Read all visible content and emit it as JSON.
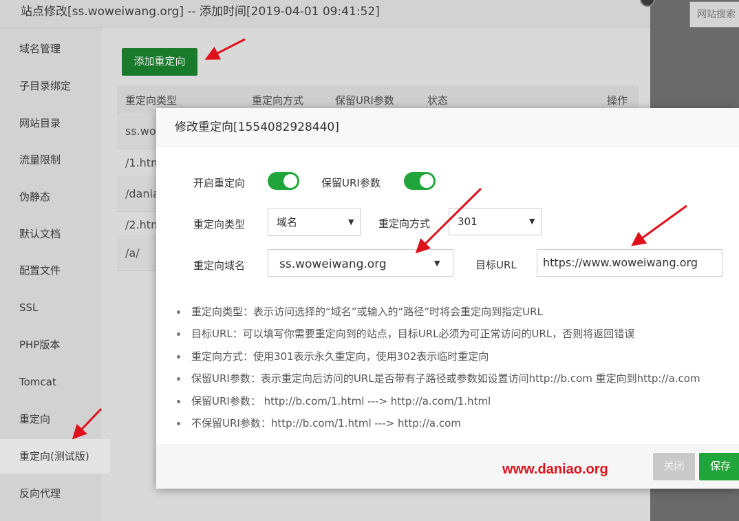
{
  "background": {
    "search_text": "网站搜索"
  },
  "outer_modal": {
    "title": "站点修改[ss.woweiwang.org] -- 添加时间[2019-04-01 09:41:52]",
    "sidebar": {
      "items": [
        {
          "label": "域名管理"
        },
        {
          "label": "子目录绑定"
        },
        {
          "label": "网站目录"
        },
        {
          "label": "流量限制"
        },
        {
          "label": "伪静态"
        },
        {
          "label": "默认文档"
        },
        {
          "label": "配置文件"
        },
        {
          "label": "SSL"
        },
        {
          "label": "PHP版本"
        },
        {
          "label": "Tomcat"
        },
        {
          "label": "重定向"
        },
        {
          "label": "重定向(测试版)"
        },
        {
          "label": "反向代理"
        }
      ],
      "active": "重定向(测试版)"
    },
    "add_button": "添加重定向",
    "table": {
      "headers": [
        "重定向类型",
        "重定向方式",
        "保留URI参数",
        "状态",
        "操作"
      ],
      "rows": [
        {
          "first_cell": "ss.wow"
        },
        {
          "first_cell": "/1.htm"
        },
        {
          "first_cell": "/dania"
        },
        {
          "first_cell": "/2.htm"
        },
        {
          "first_cell": "/a/"
        }
      ]
    }
  },
  "modal": {
    "title": "修改重定向[1554082928440]",
    "enable_label": "开启重定向",
    "enable_on": true,
    "keep_uri_label": "保留URI参数",
    "keep_uri_on": true,
    "type_label": "重定向类型",
    "type_value": "域名",
    "method_label": "重定向方式",
    "method_value": "301",
    "domain_label": "重定向域名",
    "domain_value": "ss.woweiwang.org",
    "target_label": "目标URL",
    "target_value": "https://www.woweiwang.org",
    "tips": [
      "重定向类型：表示访问选择的“域名”或输入的“路径”时将会重定向到指定URL",
      "目标URL：可以填写你需要重定向到的站点，目标URL必须为可正常访问的URL，否则将返回错误",
      "重定向方式：使用301表示永久重定向，使用302表示临时重定向",
      "保留URI参数：表示重定向后访问的URL是否带有子路径或参数如设置访问http://b.com 重定向到http://a.com",
      "保留URI参数：  http://b.com/1.html ---> http://a.com/1.html",
      "不保留URI参数：http://b.com/1.html ---> http://a.com"
    ],
    "close_button": "关闭",
    "save_button": "保存"
  },
  "watermark": "www.daniao.org",
  "colors": {
    "primary_green": "#20a53a",
    "annotation_red": "#e0101a"
  }
}
